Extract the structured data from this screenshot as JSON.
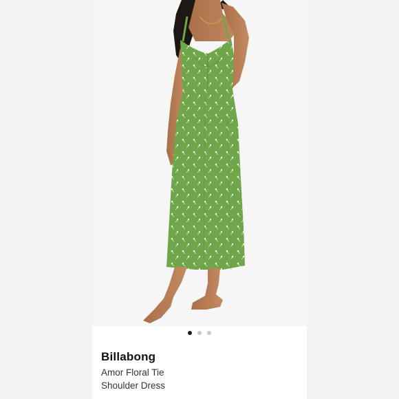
{
  "gallery": {
    "image": "model-in-green-floral-midi-dress",
    "dots": [
      {
        "active": true
      },
      {
        "active": false
      },
      {
        "active": false
      }
    ],
    "current_slide": 1,
    "total_slides": 3
  },
  "product": {
    "brand": "Billabong",
    "name": "Amor Floral Tie Shoulder Dress"
  },
  "colors": {
    "dress_green": "#6fa64a",
    "accent_dark": "#1b1b1b",
    "dot_inactive": "#c8c8c8"
  }
}
